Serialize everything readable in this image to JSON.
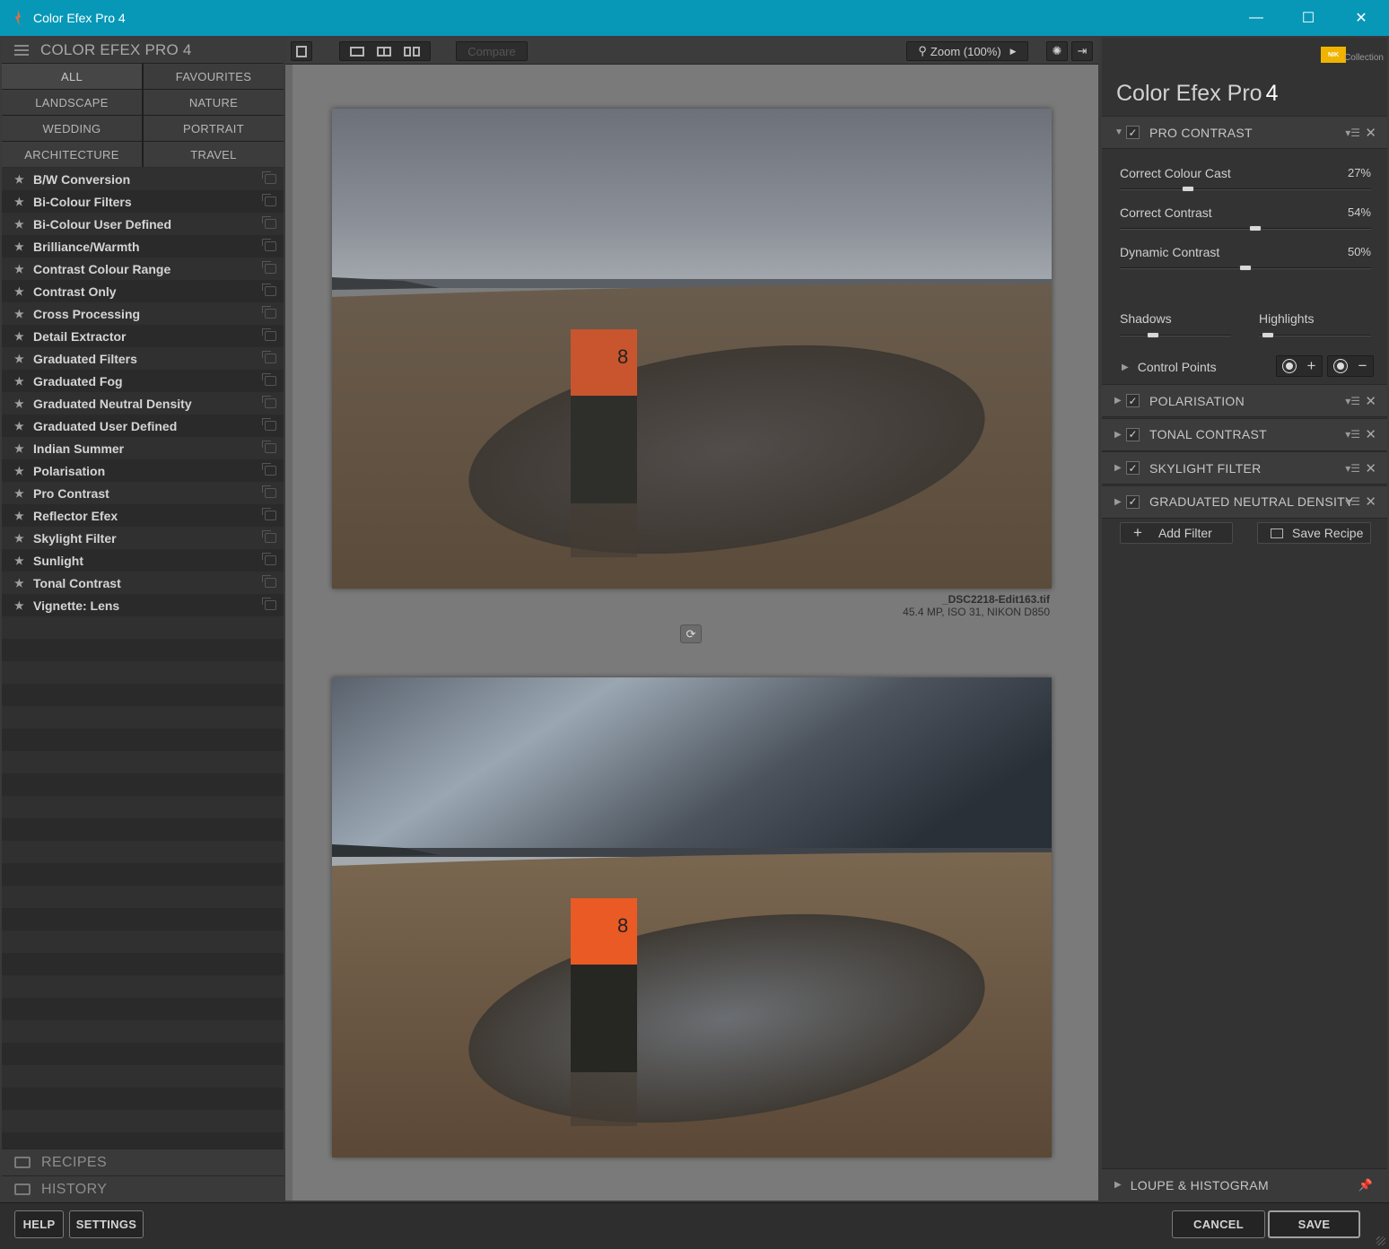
{
  "window": {
    "title": "Color Efex Pro 4",
    "minimize": "—",
    "maximize": "☐",
    "close": "✕"
  },
  "left": {
    "header": "COLOR EFEX PRO 4",
    "categories": [
      "ALL",
      "FAVOURITES",
      "LANDSCAPE",
      "NATURE",
      "WEDDING",
      "PORTRAIT",
      "ARCHITECTURE",
      "TRAVEL"
    ],
    "filters": [
      "B/W Conversion",
      "Bi-Colour Filters",
      "Bi-Colour User Defined",
      "Brilliance/Warmth",
      "Contrast Colour Range",
      "Contrast Only",
      "Cross Processing",
      "Detail Extractor",
      "Graduated Filters",
      "Graduated Fog",
      "Graduated Neutral Density",
      "Graduated User Defined",
      "Indian Summer",
      "Polarisation",
      "Pro Contrast",
      "Reflector Efex",
      "Skylight Filter",
      "Sunlight",
      "Tonal Contrast",
      "Vignette: Lens"
    ],
    "recipes": "RECIPES",
    "history": "HISTORY"
  },
  "toolbar": {
    "compare": "Compare",
    "zoom": "Zoom (100%)"
  },
  "image_info": {
    "filename": "_DSC2218-Edit163.tif",
    "details": "45.4 MP, ISO 31, NIKON D850"
  },
  "right": {
    "brand": "NIK",
    "brand_sub": "Collection",
    "app_title": "Color Efex Pro",
    "app_version": "4",
    "pro_contrast": {
      "name": "PRO CONTRAST",
      "sliders": [
        {
          "label": "Correct Colour Cast",
          "value": "27%",
          "level": 0.27
        },
        {
          "label": "Correct Contrast",
          "value": "54%",
          "level": 0.54
        },
        {
          "label": "Dynamic Contrast",
          "value": "50%",
          "level": 0.5
        }
      ],
      "shadows": {
        "label": "Shadows",
        "level": 0.3
      },
      "highlights": {
        "label": "Highlights",
        "level": 0.08
      },
      "control_points": "Control Points"
    },
    "filter_stack": [
      "POLARISATION",
      "TONAL CONTRAST",
      "SKYLIGHT FILTER",
      "GRADUATED NEUTRAL DENSITY"
    ],
    "add_filter": "Add Filter",
    "save_recipe": "Save Recipe",
    "loupe": "LOUPE & HISTOGRAM"
  },
  "bottom": {
    "help": "HELP",
    "settings": "SETTINGS",
    "cancel": "CANCEL",
    "save": "SAVE"
  },
  "colors": {
    "titlebar": "#0798b8",
    "panel": "#333333",
    "canvas": "#7a7a7a",
    "nik": "#f0b400"
  }
}
